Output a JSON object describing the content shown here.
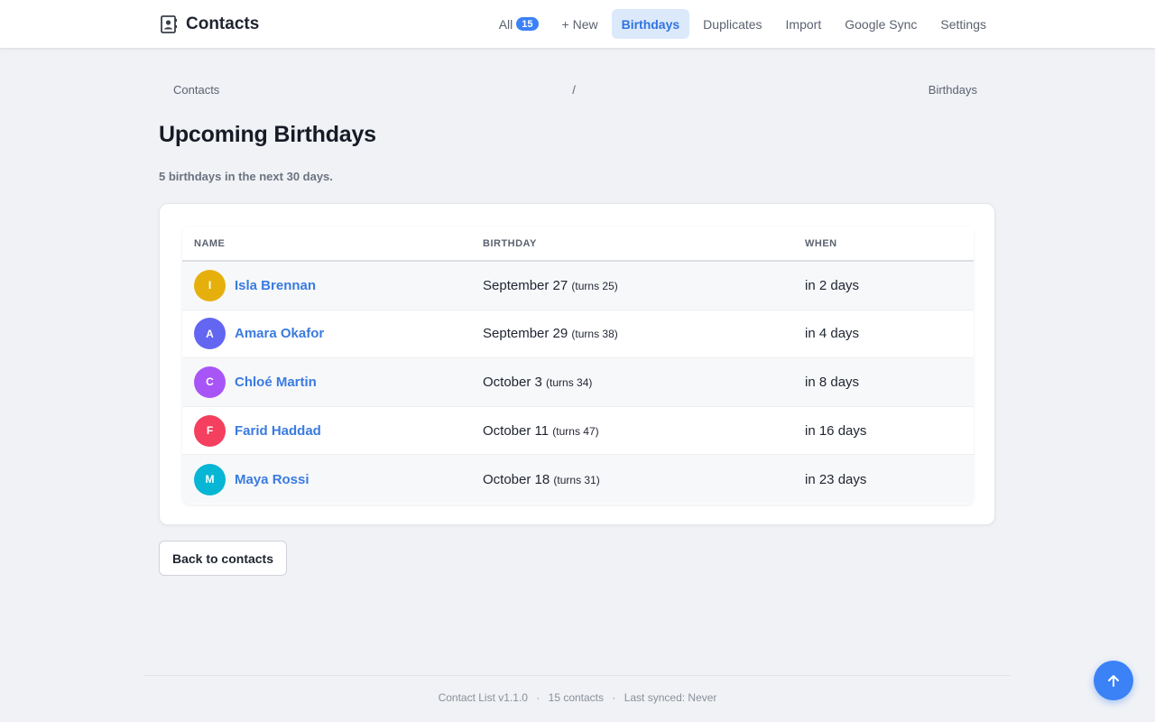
{
  "app": {
    "title": "Contacts",
    "brand_icon": "address-book-icon"
  },
  "nav": {
    "all_label": "All",
    "all_count": "15",
    "new_label": "+ New",
    "birthdays_label": "Birthdays",
    "duplicates_label": "Duplicates",
    "import_label": "Import",
    "google_sync_label": "Google Sync",
    "settings_label": "Settings",
    "active": "Birthdays"
  },
  "breadcrumb": {
    "root": "Contacts",
    "separator": "/",
    "current": "Birthdays"
  },
  "page": {
    "title": "Upcoming Birthdays",
    "subtitle": "5 birthdays in the next 30 days."
  },
  "table": {
    "headers": {
      "name": "NAME",
      "birthday": "BIRTHDAY",
      "when": "WHEN"
    },
    "rows": [
      {
        "initial": "I",
        "name": "Isla Brennan",
        "birthday": "September 27",
        "turns": "(turns 25)",
        "when": "in 2 days",
        "avatar_color": "#e6b00c"
      },
      {
        "initial": "A",
        "name": "Amara Okafor",
        "birthday": "September 29",
        "turns": "(turns 38)",
        "when": "in 4 days",
        "avatar_color": "#6366f1"
      },
      {
        "initial": "C",
        "name": "Chloé Martin",
        "birthday": "October 3",
        "turns": "(turns 34)",
        "when": "in 8 days",
        "avatar_color": "#a855f7"
      },
      {
        "initial": "F",
        "name": "Farid Haddad",
        "birthday": "October 11",
        "turns": "(turns 47)",
        "when": "in 16 days",
        "avatar_color": "#f43f5e"
      },
      {
        "initial": "M",
        "name": "Maya Rossi",
        "birthday": "October 18",
        "turns": "(turns 31)",
        "when": "in 23 days",
        "avatar_color": "#06b6d4"
      }
    ]
  },
  "actions": {
    "back_label": "Back to contacts",
    "scroll_top_icon": "arrow-up-icon"
  },
  "footer": {
    "version": "Contact List v1.1.0",
    "separator": "·",
    "contacts": "15 contacts",
    "synced": "Last synced: Never"
  },
  "colors": {
    "accent": "#3b82f6",
    "link": "#3a7be0",
    "active_nav_bg": "#dce9fb"
  }
}
